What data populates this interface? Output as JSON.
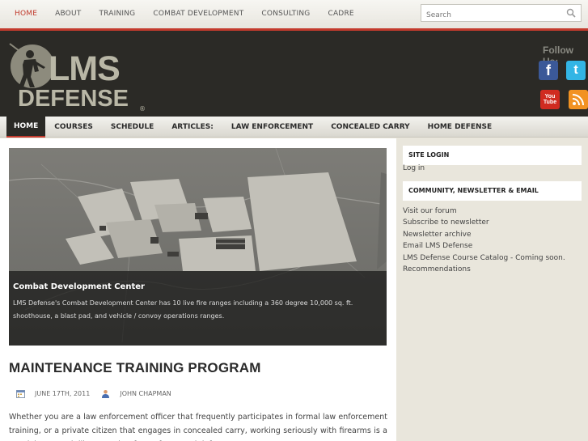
{
  "topnav": {
    "items": [
      "HOME",
      "ABOUT",
      "TRAINING",
      "COMBAT DEVELOPMENT",
      "CONSULTING",
      "CADRE"
    ],
    "search_placeholder": "Search"
  },
  "header": {
    "logo_line1": "LMS",
    "logo_line2": "DEFENSE",
    "logo_reg": "®",
    "follow_label": "Follow Us:",
    "social": {
      "facebook": "f",
      "twitter": "t",
      "youtube_1": "You",
      "youtube_2": "Tube"
    }
  },
  "mainnav": {
    "items": [
      "HOME",
      "COURSES",
      "SCHEDULE",
      "ARTICLES:",
      "LAW ENFORCEMENT",
      "CONCEALED CARRY",
      "HOME DEFENSE"
    ]
  },
  "slider": {
    "title": "Combat Development Center",
    "description": "LMS Defense's Combat Development Center has 10 live fire ranges including a 360 degree 10,000 sq. ft. shoothouse, a blast pad, and vehicle / convoy operations ranges."
  },
  "post": {
    "title": "MAINTENANCE TRAINING PROGRAM",
    "date": "JUNE 17TH, 2011",
    "author": "JOHN CHAPMAN",
    "excerpt": "Whether you are a law enforcement officer that frequently participates in formal law enforcement training, or a private citizen that engages in concealed carry, working seriously with firearms is a martial art, much like any other form of personal defense."
  },
  "sidebar": {
    "login_title": "SITE LOGIN",
    "login_link": "Log in",
    "community_title": "COMMUNITY, NEWSLETTER & EMAIL",
    "links": [
      "Visit our forum",
      "Subscribe to newsletter",
      "Newsletter archive",
      "Email LMS Defense",
      "LMS Defense Course Catalog - Coming soon.",
      "Recommendations"
    ]
  },
  "colors": {
    "accent": "#c43b2e",
    "header_bg": "#2b2a26",
    "sidebar_bg": "#e9e6dc"
  }
}
